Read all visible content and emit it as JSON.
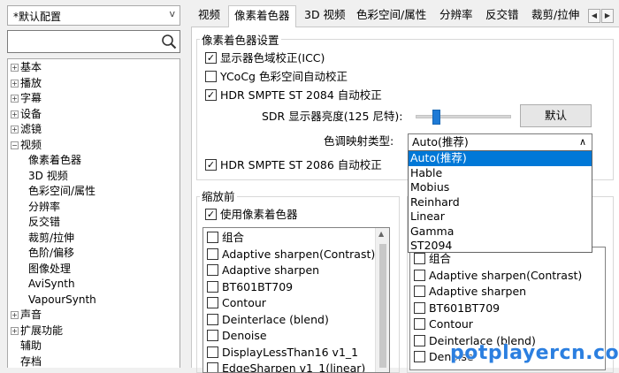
{
  "profile": {
    "value": "*默认配置"
  },
  "search": {
    "placeholder": ""
  },
  "tree": {
    "items": [
      {
        "label": "基本",
        "expander": "+"
      },
      {
        "label": "播放",
        "expander": "+"
      },
      {
        "label": "字幕",
        "expander": "+"
      },
      {
        "label": "设备",
        "expander": "+"
      },
      {
        "label": "滤镜",
        "expander": "+"
      },
      {
        "label": "视频",
        "expander": "−"
      },
      {
        "label": "像素着色器"
      },
      {
        "label": "3D 视频"
      },
      {
        "label": "色彩空间/属性"
      },
      {
        "label": "分辨率"
      },
      {
        "label": "反交错"
      },
      {
        "label": "裁剪/拉伸"
      },
      {
        "label": "色阶/偏移"
      },
      {
        "label": "图像处理"
      },
      {
        "label": "AviSynth"
      },
      {
        "label": "VapourSynth"
      },
      {
        "label": "声音",
        "expander": "+"
      },
      {
        "label": "扩展功能",
        "expander": "+"
      },
      {
        "label": "辅助"
      },
      {
        "label": "存档"
      }
    ]
  },
  "tabs": [
    "视频",
    "像素着色器",
    "3D 视频",
    "色彩空间/属性",
    "分辨率",
    "反交错",
    "裁剪/拉伸"
  ],
  "shader_settings": {
    "title": "像素着色器设置",
    "icc": "显示器色域校正(ICC)",
    "ycocg": "YCoCg 色彩空间自动校正",
    "hdr2084": "HDR SMPTE ST 2084 自动校正",
    "sdr_label": "SDR 显示器亮度(125 尼特):",
    "default_btn": "默认",
    "tonemap_label": "色调映射类型:",
    "tonemap_value": "Auto(推荐)",
    "hdr2086": "HDR SMPTE ST 2086 自动校正"
  },
  "tonemap_options": [
    "Auto(推荐)",
    "Hable",
    "Mobius",
    "Reinhard",
    "Linear",
    "Gamma",
    "ST2094"
  ],
  "before_scale": {
    "title": "缩放前",
    "use_shader": "使用像素着色器",
    "items": [
      "组合",
      "Adaptive sharpen(Contrast)",
      "Adaptive sharpen",
      "BT601BT709",
      "Contour",
      "Deinterlace (blend)",
      "Denoise",
      "DisplayLessThan16 v1_1",
      "EdgeSharpen v1_1(linear)"
    ]
  },
  "after_scale": {
    "items": [
      "组合",
      "Adaptive sharpen(Contrast)",
      "Adaptive sharpen",
      "BT601BT709",
      "Contour",
      "Deinterlace (blend)",
      "Denoise"
    ]
  },
  "watermark": "potplayercn.com"
}
